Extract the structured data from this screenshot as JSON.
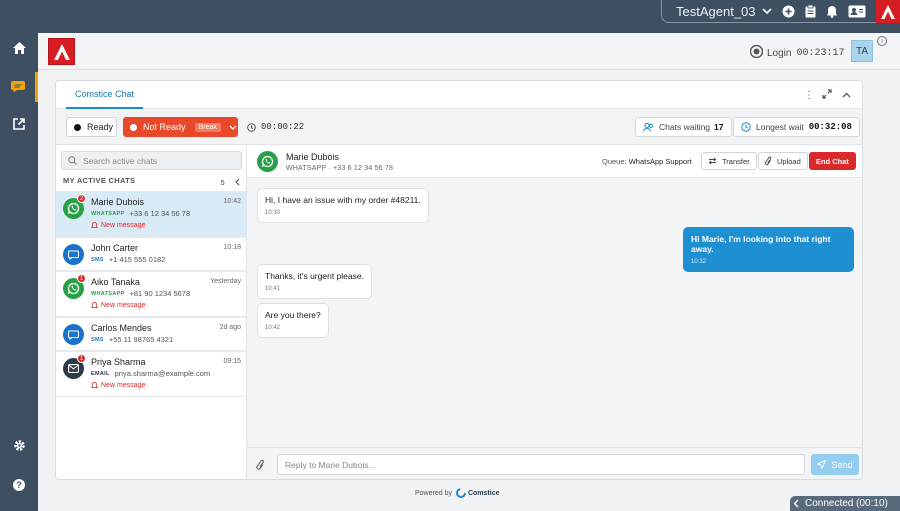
{
  "topbar": {
    "agent_name": "TestAgent_03"
  },
  "header": {
    "login_label": "Login",
    "login_timer": "00:23:17",
    "avatar_initials": "TA"
  },
  "tabs": [
    {
      "label": "Comstice Chat",
      "active": true
    }
  ],
  "status": {
    "ready_label": "Ready",
    "not_ready_label": "Not Ready",
    "break_label": "Break",
    "state_timer": "00:00:22",
    "chats_waiting_label": "Chats waiting",
    "chats_waiting_count": "17",
    "longest_wait_label": "Longest wait",
    "longest_wait_time": "00:32:08"
  },
  "sidebar": {
    "search_placeholder": "Search active chats",
    "section_title": "MY ACTIVE CHATS",
    "section_count": "5",
    "chats": [
      {
        "name": "Marie Dubois",
        "time": "10:42",
        "channel": "WHATSAPP",
        "contact": "+33 6 12 34 56 78",
        "badge": "2",
        "new_message": "New message"
      },
      {
        "name": "John Carter",
        "time": "10:18",
        "channel": "SMS",
        "contact": "+1 415 555 0182"
      },
      {
        "name": "Aiko Tanaka",
        "time": "Yesterday",
        "channel": "WHATSAPP",
        "contact": "+81 90 1234 5678",
        "badge": "1",
        "new_message": "New message"
      },
      {
        "name": "Carlos Mendes",
        "time": "2d ago",
        "channel": "SMS",
        "contact": "+55 11 98765 4321"
      },
      {
        "name": "Priya Sharma",
        "time": "09:15",
        "channel": "EMAIL",
        "contact": "priya.sharma@example.com",
        "badge": "1",
        "new_message": "New message"
      }
    ]
  },
  "chat": {
    "contact_name": "Marie Dubois",
    "contact_sub": "WHATSAPP · +33 6 12 34 56 78",
    "queue_label": "Queue:",
    "queue_name": "WhatsApp Support",
    "transfer_label": "Transfer",
    "upload_label": "Upload",
    "end_label": "End Chat",
    "messages": [
      {
        "text": "Hi, I have an issue with my order #48211.",
        "time": "10:30",
        "direction": "in"
      },
      {
        "text": "Hi Marie, I'm looking into that right away.",
        "time": "10:32",
        "direction": "out"
      },
      {
        "text": "Thanks, it's urgent please.",
        "time": "10:41",
        "direction": "in"
      },
      {
        "text": "Are you there?",
        "time": "10:42",
        "direction": "in"
      }
    ],
    "reply_placeholder": "Reply to Marie Dubois...",
    "send_label": "Send"
  },
  "footer": {
    "powered_by": "Powered by",
    "brand": "Comstice",
    "connection": "Connected (00:10)"
  },
  "colors": {
    "accent": "#1e8fd0",
    "not_ready": "#e8492a",
    "danger": "#d9292b",
    "whatsapp": "#27a047",
    "sms": "#1a73c9",
    "email": "#2e3a4a",
    "nav_bg": "#3e4f62"
  }
}
